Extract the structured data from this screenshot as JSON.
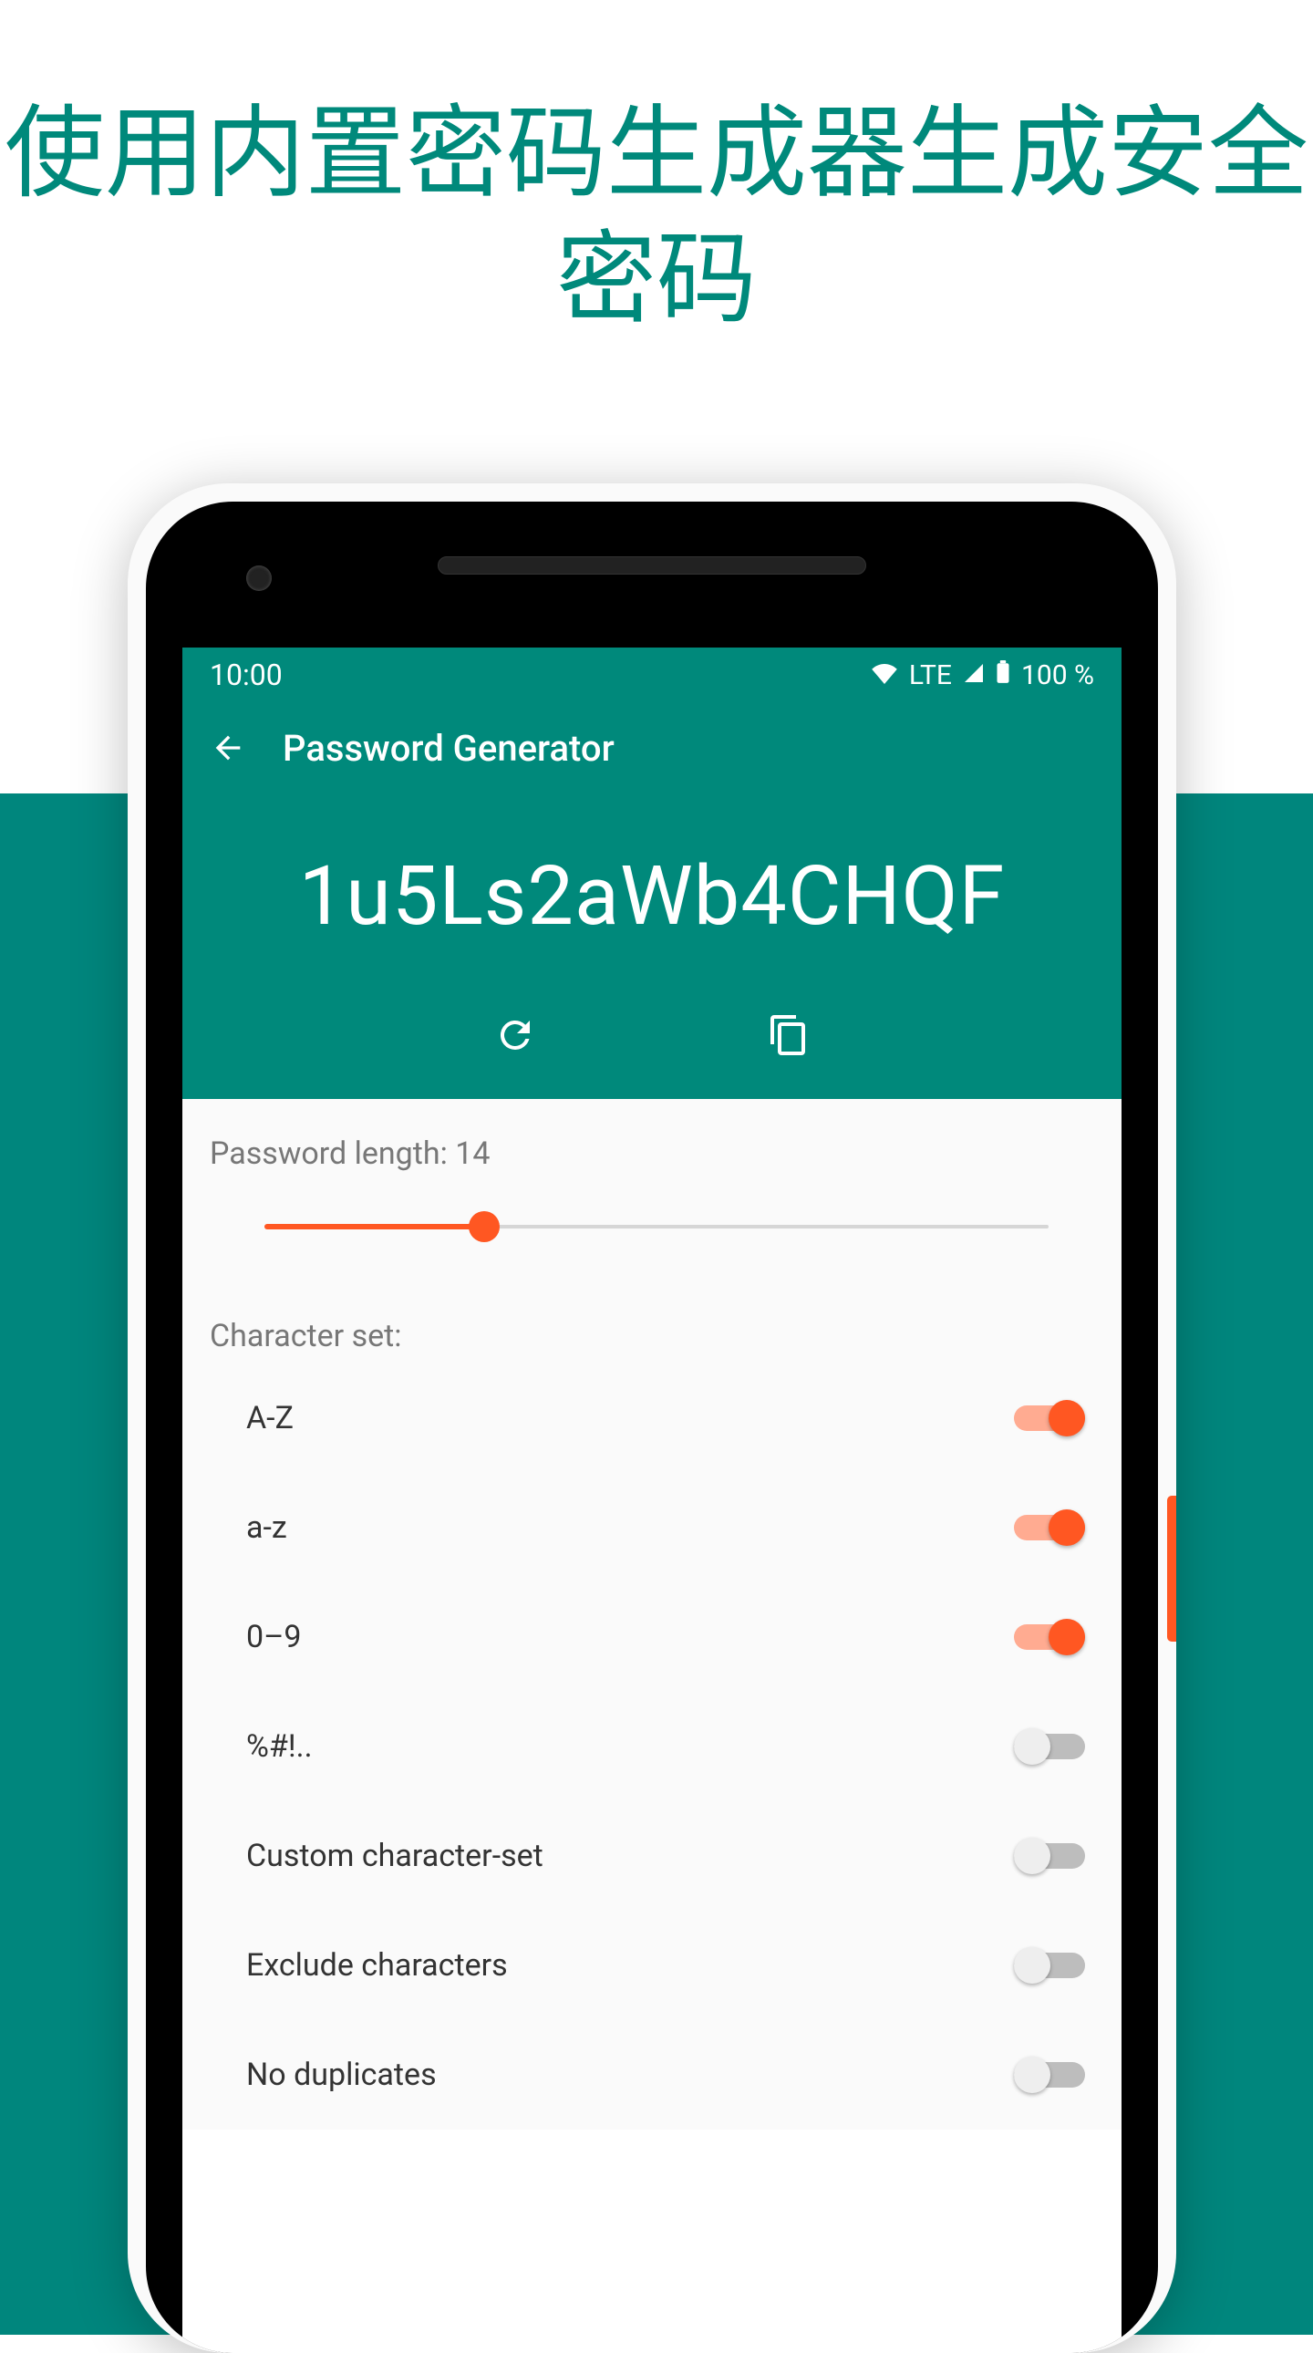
{
  "promo": {
    "headline": "使用内置密码生成器生成安全密码"
  },
  "statusbar": {
    "time": "10:00",
    "network": "LTE",
    "battery_text": "100 %"
  },
  "toolbar": {
    "title": "Password Generator"
  },
  "password": {
    "value": "1u5Ls2aWb4CHQF"
  },
  "length": {
    "label_prefix": "Password length: ",
    "value": "14",
    "slider_percent": 28
  },
  "charset": {
    "label": "Character set:",
    "items": [
      {
        "label": "A-Z",
        "on": true
      },
      {
        "label": "a-z",
        "on": true
      },
      {
        "label": "0–9",
        "on": true
      },
      {
        "label": "%#!..",
        "on": false
      },
      {
        "label": "Custom character-set",
        "on": false
      },
      {
        "label": "Exclude characters",
        "on": false
      },
      {
        "label": "No duplicates",
        "on": false
      }
    ]
  },
  "colors": {
    "accent": "#ff5722",
    "teal": "#00897b"
  }
}
